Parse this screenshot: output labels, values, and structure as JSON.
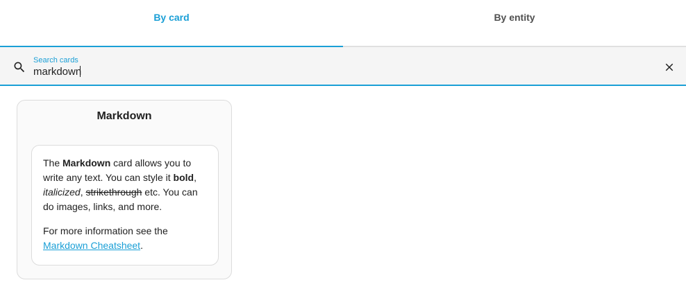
{
  "tabs": [
    {
      "label": "By card",
      "active": true
    },
    {
      "label": "By entity",
      "active": false
    }
  ],
  "search": {
    "label": "Search cards",
    "value": "markdown",
    "icon": "search-icon",
    "clear_icon": "close-icon"
  },
  "card": {
    "title": "Markdown",
    "preview": {
      "p1": {
        "t1": "The ",
        "b1": "Markdown",
        "t2": " card allows you to write any text. You can style it ",
        "b2": "bold",
        "t3": ", ",
        "i1": "italicized",
        "t4": ", ",
        "s1": "strikethrough",
        "t5": " etc. You can do images, links, and more."
      },
      "p2": {
        "t1": "For more information see the ",
        "link": "Markdown Cheatsheet",
        "t2": "."
      }
    }
  },
  "colors": {
    "accent": "#1a9fd6",
    "search_bg": "#f5f5f5",
    "card_bg": "#fafafa"
  }
}
